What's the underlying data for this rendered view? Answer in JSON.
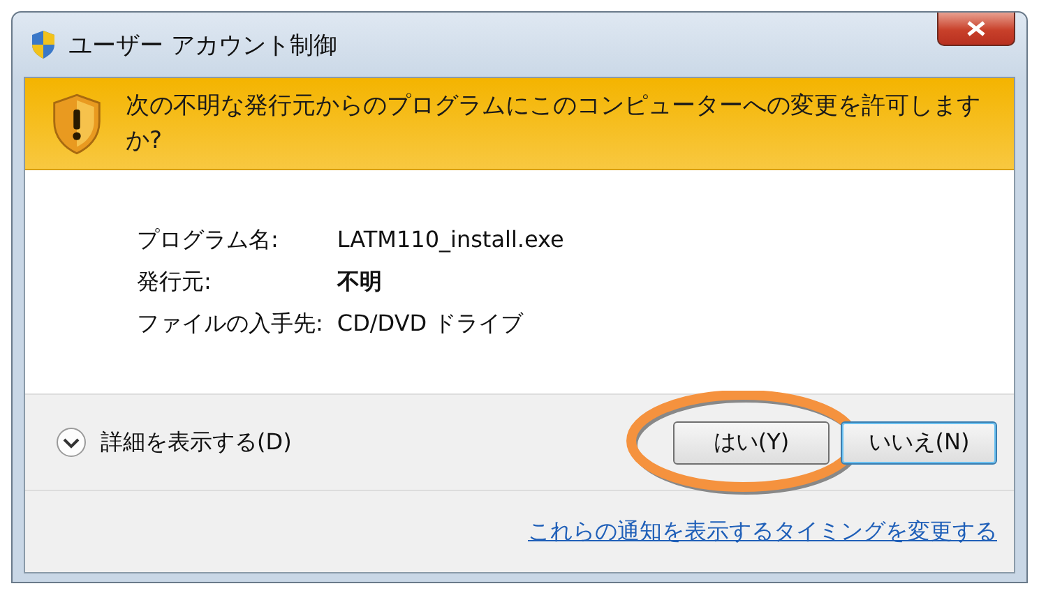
{
  "window": {
    "title": "ユーザー アカウント制御"
  },
  "banner": {
    "message": "次の不明な発行元からのプログラムにこのコンピューターへの変更を許可しますか?"
  },
  "details": [
    {
      "label": "プログラム名:",
      "value": "LATM110_install.exe",
      "bold": false
    },
    {
      "label": "発行元:",
      "value": "不明",
      "bold": true
    },
    {
      "label": "ファイルの入手先:",
      "value": "CD/DVD ドライブ",
      "bold": false
    }
  ],
  "expander": {
    "label": "詳細を表示する(D)",
    "expanded": false
  },
  "buttons": [
    {
      "label": "はい(Y)",
      "focused": false,
      "highlighted": true
    },
    {
      "label": "いいえ(N)",
      "focused": true,
      "highlighted": false
    }
  ],
  "link": "これらの通知を表示するタイミングを変更する"
}
